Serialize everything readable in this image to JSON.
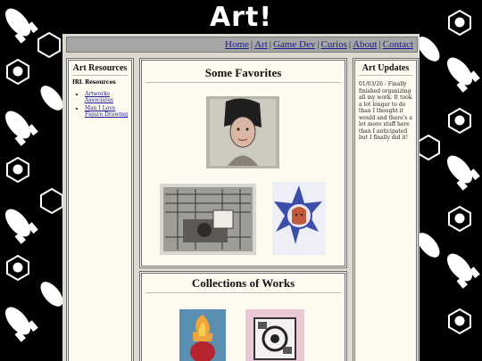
{
  "site": {
    "title": "Art!"
  },
  "nav": {
    "items": [
      {
        "label": "Home"
      },
      {
        "label": "Art"
      },
      {
        "label": "Game Dev"
      },
      {
        "label": "Curios"
      },
      {
        "label": "About"
      },
      {
        "label": "Contact"
      }
    ]
  },
  "resources": {
    "title": "Art Resources",
    "subtitle": "IRL Resources",
    "links": [
      {
        "label": "Artworks Associates"
      },
      {
        "label": "Man I Love Figure Drawing"
      }
    ]
  },
  "favorites": {
    "title": "Some Favorites"
  },
  "collections": {
    "title": "Collections of Works"
  },
  "updates": {
    "title": "Art Updates",
    "entries": [
      {
        "text": "01/03/26 - Finally finished organizing all my work. It took a lot longer to do than I thought it would and there's a lot more stuff here than I anticipated but I finally did it!"
      }
    ]
  }
}
